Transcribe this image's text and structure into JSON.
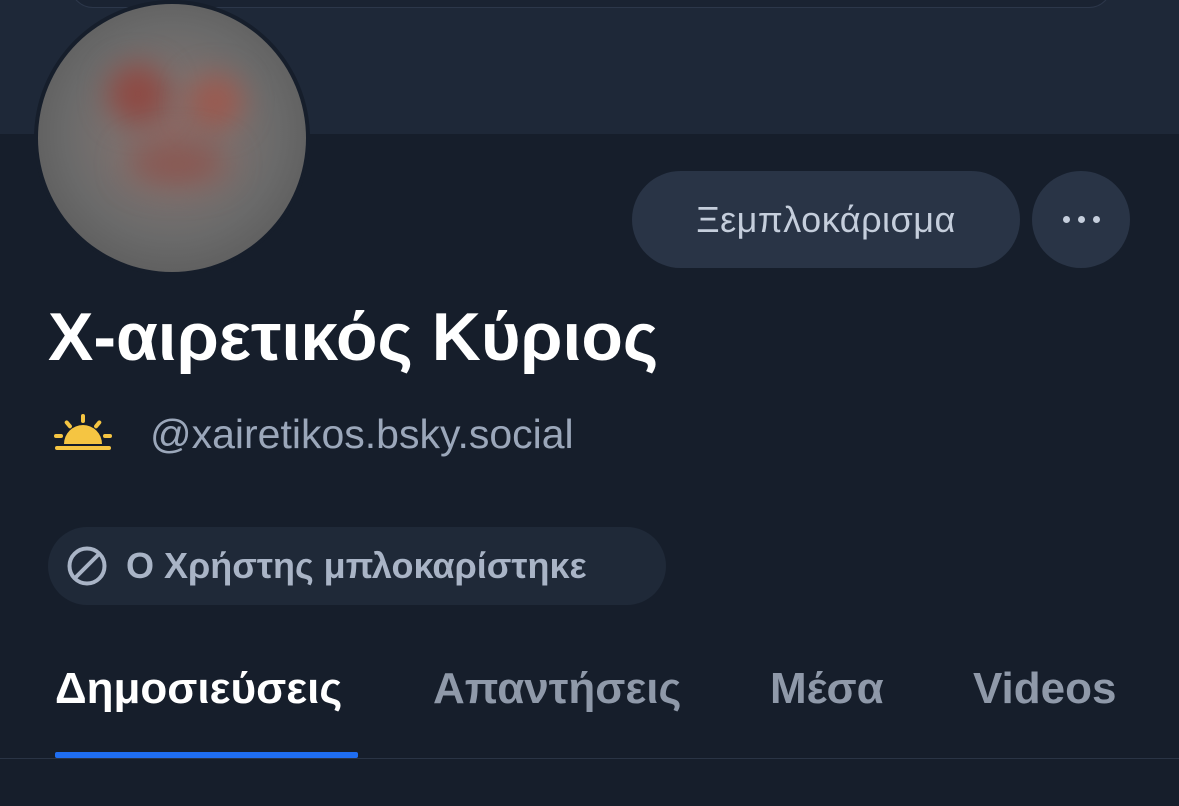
{
  "profile": {
    "display_name": "Χ-αιρετικός Κύριος",
    "handle": "@xairetikos.bsky.social",
    "badge_icon": "sunrise-icon"
  },
  "actions": {
    "unblock_label": "Ξεμπλοκάρισμα",
    "more_icon": "more-horizontal-icon"
  },
  "status": {
    "blocked_label": "Ο Χρήστης μπλοκαρίστηκε",
    "blocked_icon": "blocked-circle-icon"
  },
  "tabs": [
    {
      "label": "Δημοσιεύσεις",
      "active": true
    },
    {
      "label": "Απαντήσεις",
      "active": false
    },
    {
      "label": "Μέσα",
      "active": false
    },
    {
      "label": "Videos",
      "active": false
    }
  ],
  "colors": {
    "background": "#161e2b",
    "banner": "#1e2838",
    "button": "#293446",
    "accent": "#1f6ef2",
    "sun": "#f5c542"
  }
}
